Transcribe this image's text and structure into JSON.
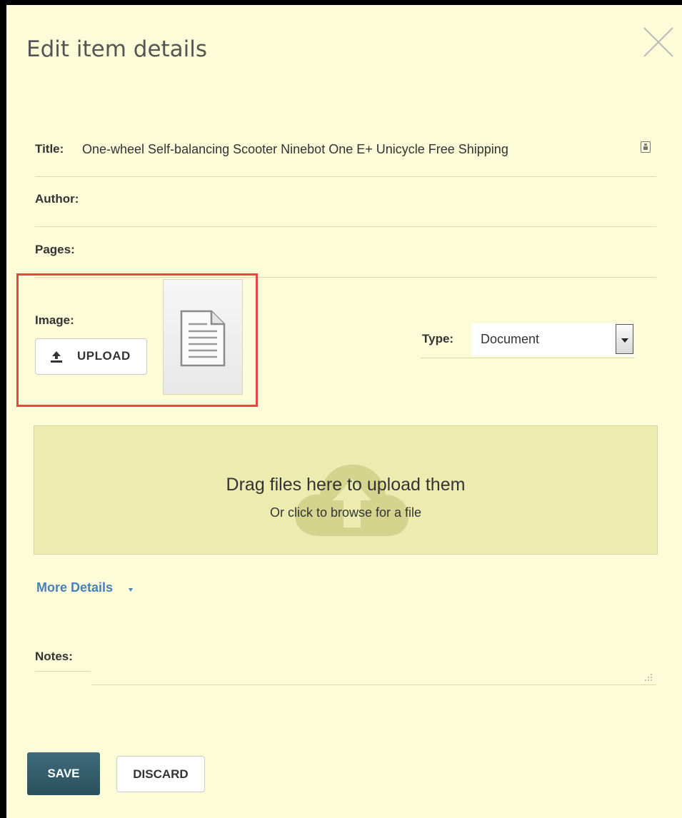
{
  "dialog": {
    "title": "Edit item details"
  },
  "fields": {
    "title_label": "Title:",
    "title_value": "One-wheel Self-balancing Scooter Ninebot One E+ Unicycle Free Shipping",
    "author_label": "Author:",
    "author_value": "",
    "pages_label": "Pages:",
    "pages_value": ""
  },
  "image": {
    "label": "Image:",
    "upload_label": "UPLOAD",
    "upload_icon": "upload-icon",
    "thumbnail_icon": "document-icon"
  },
  "type": {
    "label": "Type:",
    "selected": "Document"
  },
  "dropzone": {
    "title": "Drag files here to upload them",
    "subtitle": "Or click to browse for a file",
    "icon": "cloud-upload-icon"
  },
  "more_details": {
    "label": "More Details"
  },
  "notes": {
    "label": "Notes:",
    "value": ""
  },
  "actions": {
    "save_label": "SAVE",
    "discard_label": "DISCARD"
  },
  "colors": {
    "dialog_background": "#fcfcd8",
    "dropzone_background": "#ececb0",
    "highlight_border": "#e04a3f",
    "link": "#4a80b8",
    "save_button": "#2f5664"
  }
}
